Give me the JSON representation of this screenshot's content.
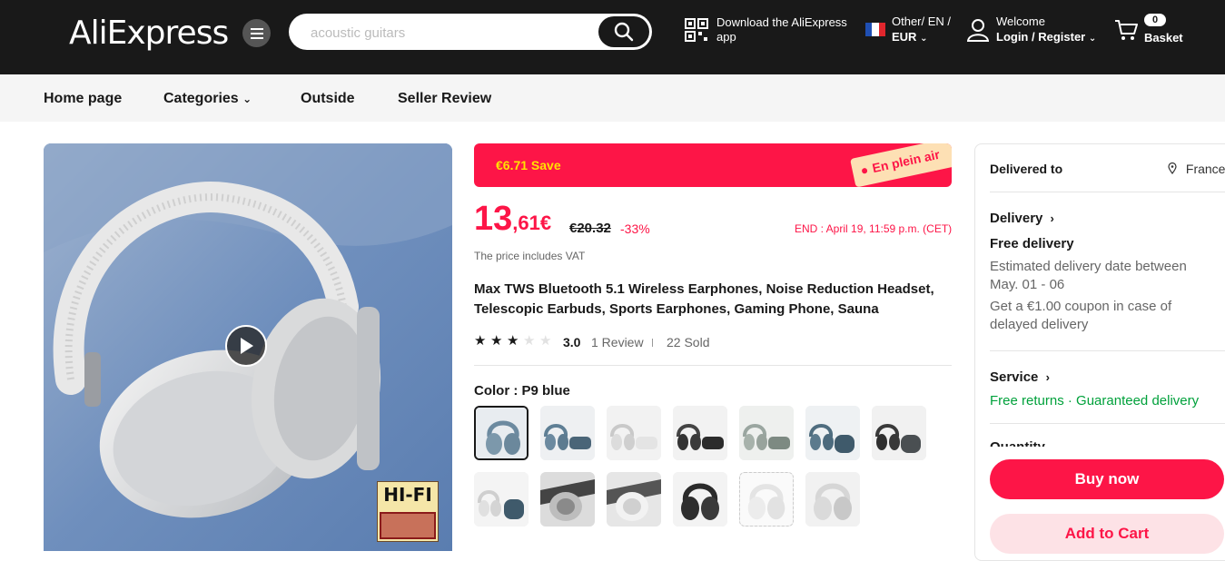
{
  "header": {
    "logo": "AliExpress",
    "search_placeholder": "acoustic guitars",
    "app_download": "Download the AliExpress app",
    "lang_line1": "Other/ EN /",
    "lang_line2": "EUR",
    "welcome": "Welcome",
    "login": "Login / Register",
    "cart_count": "0",
    "cart_label": "Basket"
  },
  "nav": {
    "items": [
      "Home page",
      "Categories",
      "Outside",
      "Seller Review"
    ]
  },
  "gallery": {
    "badge_text": "HI-FI"
  },
  "promo": {
    "save": "€6.71 Save",
    "tag": "En plein air"
  },
  "price": {
    "integer": "13",
    "cents": ",61€",
    "original": "€20.32",
    "discount": "-33%",
    "end": "END : April 19, 11:59 p.m. (CET)",
    "vat_note": "The price includes VAT"
  },
  "product": {
    "title": "Max TWS Bluetooth 5.1 Wireless Earphones, Noise Reduction Headset, Telescopic Earbuds, Sports Earphones, Gaming Phone, Sauna",
    "rating_stars": 3,
    "rating": "3.0",
    "reviews": "1 Review",
    "sold": "22 Sold",
    "color_label": "Color : P9 blue"
  },
  "side": {
    "delivered_to_label": "Delivered to",
    "country": "France",
    "delivery_title": "Delivery",
    "free_delivery": "Free delivery",
    "estimate": "Estimated delivery date between May. 01 - 06",
    "coupon": "Get a €1.00 coupon in case of delayed delivery",
    "service_title": "Service",
    "free_returns": "Free returns",
    "guaranteed": "Guaranteed delivery",
    "quantity_partial": "Quantity",
    "buy_now": "Buy now",
    "add_to_cart": "Add to Cart"
  },
  "colors": {
    "brand_red": "#fd1547",
    "topbar": "#191919",
    "service_green": "#00a13b"
  }
}
